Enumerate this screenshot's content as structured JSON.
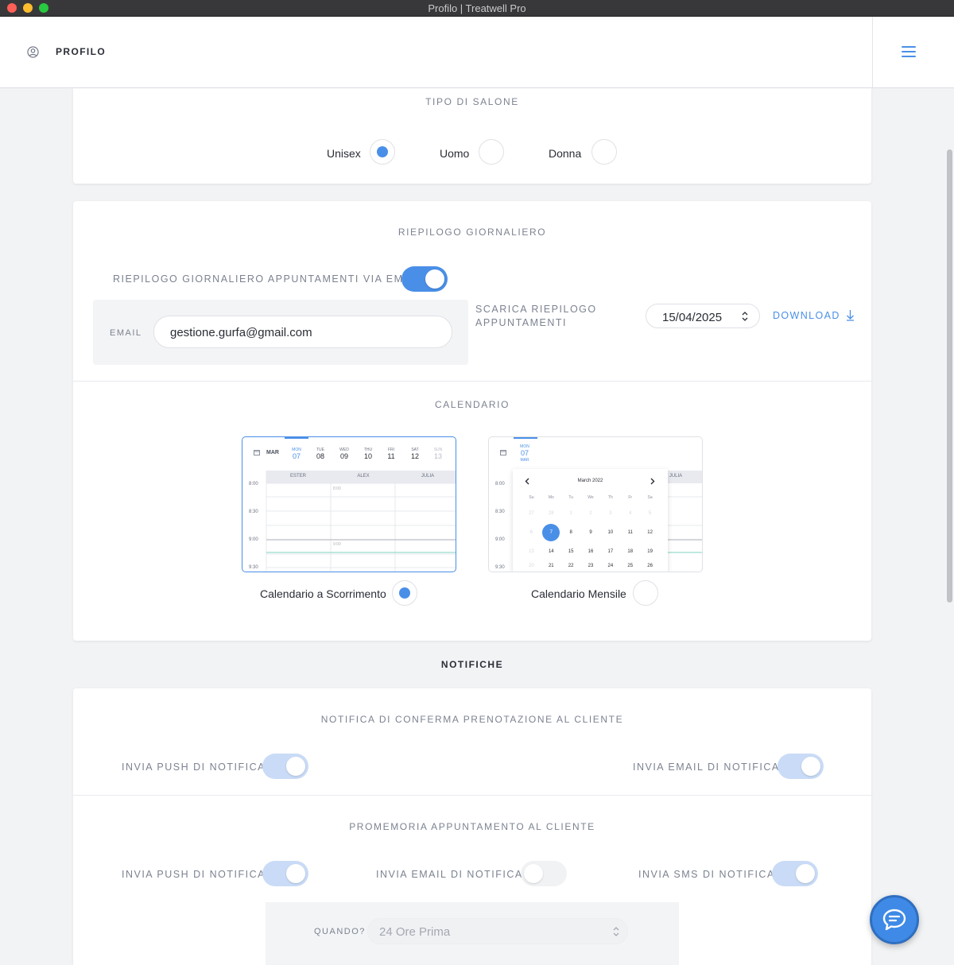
{
  "window": {
    "title": "Profilo | Treatwell Pro"
  },
  "header": {
    "title": "PROFILO"
  },
  "salon_type": {
    "title": "TIPO DI SALONE",
    "options": [
      {
        "label": "Unisex",
        "selected": true
      },
      {
        "label": "Uomo",
        "selected": false
      },
      {
        "label": "Donna",
        "selected": false
      }
    ]
  },
  "daily_summary": {
    "title": "RIEPILOGO GIORNALIERO",
    "email_toggle_label": "RIEPILOGO GIORNALIERO APPUNTAMENTI VIA EMAIL",
    "email_toggle_on": true,
    "email_label": "EMAIL",
    "email_value": "gestione.gurfa@gmail.com",
    "download_label_line1": "SCARICA RIEPILOGO",
    "download_label_line2": "APPUNTAMENTI",
    "date_value": "15/04/2025",
    "download_button": "DOWNLOAD"
  },
  "calendar": {
    "title": "CALENDARIO",
    "options": [
      {
        "label": "Calendario a Scorrimento",
        "selected": true
      },
      {
        "label": "Calendario Mensile",
        "selected": false
      }
    ],
    "preview_scroll": {
      "month": "MAR",
      "days": [
        {
          "dow": "MON",
          "num": "07"
        },
        {
          "dow": "TUE",
          "num": "08"
        },
        {
          "dow": "WED",
          "num": "09"
        },
        {
          "dow": "THU",
          "num": "10"
        },
        {
          "dow": "FRI",
          "num": "11"
        },
        {
          "dow": "SAT",
          "num": "12"
        },
        {
          "dow": "SUN",
          "num": "13"
        }
      ],
      "staff": [
        "ESTER",
        "ALEX",
        "JULIA"
      ],
      "times": [
        "8:00",
        "8:30",
        "9:00",
        "9:30"
      ],
      "inner_times": [
        "8:00",
        "9:00"
      ]
    },
    "preview_month": {
      "day_dow": "MON",
      "day_num": "07",
      "day_month": "MAR",
      "times": [
        "8:00",
        "8:30",
        "9:00",
        "9:30"
      ],
      "staff_visible": "JULIA",
      "month_title": "March 2022",
      "weekdays": [
        "Su",
        "Mo",
        "Tu",
        "We",
        "Th",
        "Fr",
        "Sa"
      ],
      "week1": [
        "27",
        "28",
        "1",
        "2",
        "3",
        "4",
        "5"
      ],
      "week2": [
        "6",
        "7",
        "8",
        "9",
        "10",
        "11",
        "12"
      ],
      "week3": [
        "13",
        "14",
        "15",
        "16",
        "17",
        "18",
        "19"
      ],
      "week4": [
        "20",
        "21",
        "22",
        "23",
        "24",
        "25",
        "26"
      ]
    }
  },
  "notifications": {
    "heading": "NOTIFICHE",
    "confirmation": {
      "title": "NOTIFICA DI CONFERMA PRENOTAZIONE AL CLIENTE",
      "push_label": "INVIA PUSH DI NOTIFICA",
      "email_label": "INVIA EMAIL DI NOTIFICA"
    },
    "reminder": {
      "title": "PROMEMORIA APPUNTAMENTO AL CLIENTE",
      "push_label": "INVIA PUSH DI NOTIFICA",
      "email_label": "INVIA EMAIL DI NOTIFICA",
      "sms_label": "INVIA SMS DI NOTIFICA",
      "when_label": "QUANDO?",
      "when_value": "24 Ore Prima"
    }
  },
  "colors": {
    "accent": "#4a8fe7",
    "chat": "#3f8ae6"
  }
}
